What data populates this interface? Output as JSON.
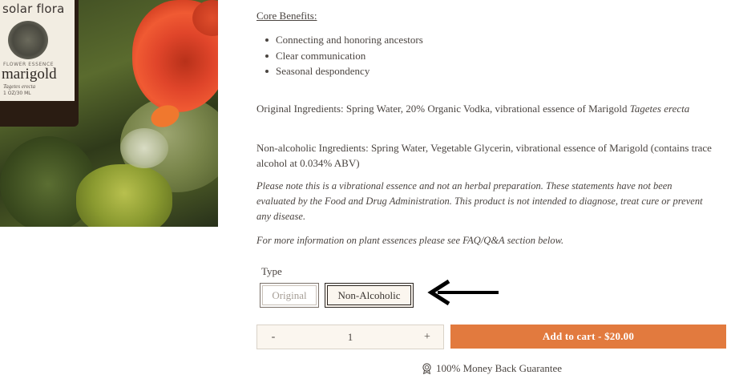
{
  "product_image": {
    "brand": "solar flora",
    "category": "FLOWER ESSENCE",
    "name": "marigold",
    "latin": "Tagetes erecta",
    "volume": "1 OZ/30 ML"
  },
  "details": {
    "core_heading": "Core Benefits:",
    "benefits": [
      "Connecting and honoring ancestors",
      "Clear communication",
      "Seasonal despondency"
    ],
    "original_ingredients": "Original Ingredients: Spring Water, 20% Organic Vodka, vibrational essence of Marigold ",
    "original_latin": "Tagetes erecta",
    "nonalcoholic_ingredients": "Non-alcoholic Ingredients: Spring Water, Vegetable Glycerin, vibrational essence of Marigold (contains trace alcohol at 0.034% ABV)",
    "disclaimer": "Please note this is a vibrational essence and not an herbal preparation. These statements have not been evaluated by the Food and Drug Administration. This product is not intended to diagnose, treat cure or prevent any disease.",
    "more_info": "For more information on plant essences please see FAQ/Q&A section below."
  },
  "type_selector": {
    "label": "Type",
    "options": [
      "Original",
      "Non-Alcoholic"
    ],
    "selected": "Non-Alcoholic"
  },
  "quantity": {
    "minus": "-",
    "value": "1",
    "plus": "+"
  },
  "cart": {
    "button_label": "Add to cart - $20.00"
  },
  "guarantee": {
    "text": "100% Money Back Guarantee",
    "icon": "badge-icon"
  }
}
